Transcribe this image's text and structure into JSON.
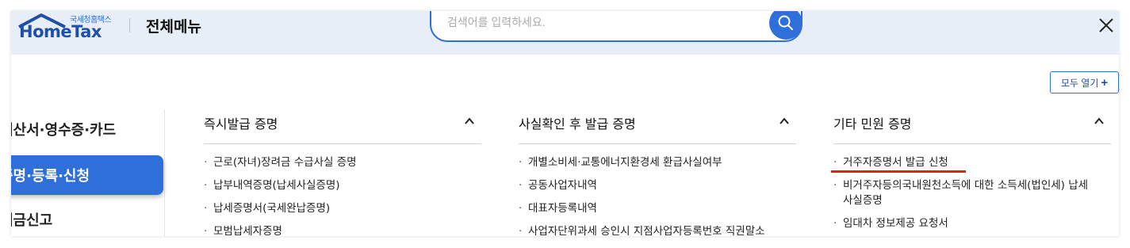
{
  "header": {
    "logo_small": "국세청홈택스",
    "logo_main": "HomeTax",
    "page_title": "전체메뉴",
    "search_placeholder": "검색어를 입력하세요.",
    "search_icon": "search-icon",
    "close_icon": "close-icon"
  },
  "toolbar": {
    "expand_all_label": "모두 열기",
    "expand_icon": "plus-icon"
  },
  "sidebar": {
    "items": [
      {
        "label": "계산서·영수증·카드",
        "active": false
      },
      {
        "label": "증명·등록·신청",
        "active": true
      },
      {
        "label": "세금신고",
        "active": false
      }
    ]
  },
  "sections": [
    {
      "title": "즉시발급 증명",
      "expanded": true,
      "items": [
        "근로(자녀)장려금 수급사실 증명",
        "납부내역증명(납세사실증명)",
        "납세증명서(국세완납증명)",
        "모범납세자증명"
      ]
    },
    {
      "title": "사실확인 후 발급 증명",
      "expanded": true,
      "items": [
        "개별소비세·교통에너지환경세 환급사실여부",
        "공동사업자내역",
        "대표자등록내역",
        "사업자단위과세 승인시 지점사업자등록번호 직권말소"
      ]
    },
    {
      "title": "기타 민원 증명",
      "expanded": true,
      "items": [
        "거주자증명서 발급 신청",
        "비거주자등의국내원천소득에 대한 소득세(법인세) 납세사실증명",
        "임대차 정보제공 요청서"
      ]
    }
  ],
  "colors": {
    "accent": "#2f6fd9",
    "header_bg": "#e8eef8",
    "highlight_underline": "#e02020"
  }
}
